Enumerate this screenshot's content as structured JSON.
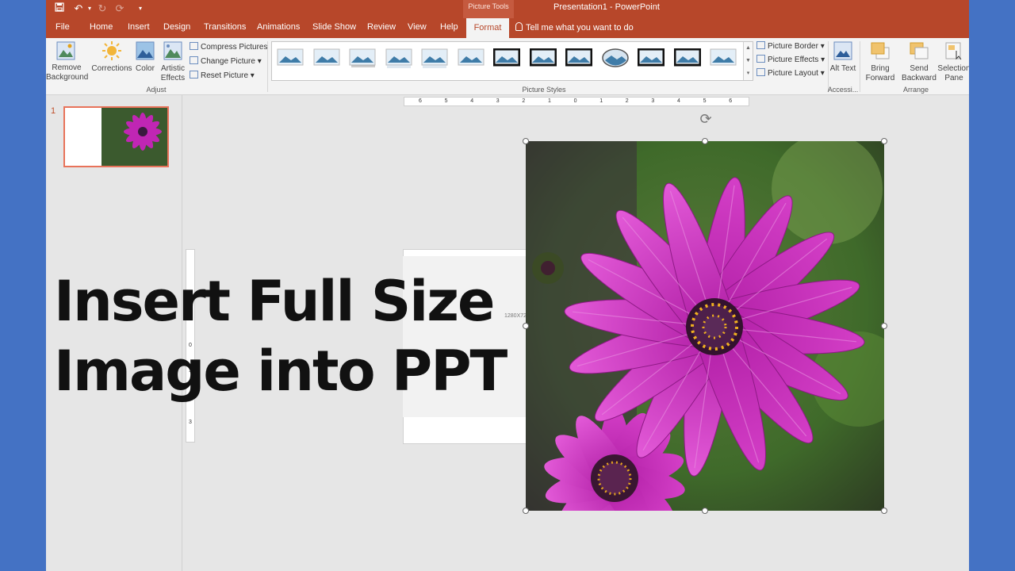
{
  "app": {
    "window_title": "Presentation1  -  PowerPoint",
    "context_tab_group": "Picture Tools",
    "tell_me": "Tell me what you want to do",
    "colors": {
      "accent": "#b7472a",
      "frame": "#4472c4",
      "selection": "#e8735a"
    }
  },
  "quick_access": [
    {
      "icon": "save-icon",
      "glyph": "💾"
    },
    {
      "icon": "undo-icon",
      "glyph": "↶"
    },
    {
      "icon": "redo-icon",
      "glyph": "↻"
    },
    {
      "icon": "customize-icon",
      "glyph": "▾"
    }
  ],
  "tabs": [
    "File",
    "Home",
    "Insert",
    "Design",
    "Transitions",
    "Animations",
    "Slide Show",
    "Review",
    "View",
    "Help"
  ],
  "active_tab": "Format",
  "ribbon": {
    "adjust": {
      "remove_background": "Remove Background",
      "corrections": "Corrections",
      "color": "Color",
      "artistic_effects": "Artistic Effects",
      "compress": "Compress Pictures",
      "change": "Change Picture",
      "reset": "Reset Picture",
      "group_name": "Adjust"
    },
    "picture_styles": {
      "group_name": "Picture Styles",
      "picture_border": "Picture Border",
      "picture_effects": "Picture Effects",
      "picture_layout": "Picture Layout"
    },
    "accessibility": {
      "alt_text": "Alt Text",
      "group_name": "Accessi..."
    },
    "arrange": {
      "bring_forward": "Bring Forward",
      "send_backward": "Send Backward",
      "selection_pane": "Selection Pane",
      "group_name": "Arrange"
    }
  },
  "slides_pane": {
    "slide_number": "1"
  },
  "rulers": {
    "horizontal": [
      "6",
      "5",
      "4",
      "3",
      "2",
      "1",
      "0",
      "1",
      "2",
      "3",
      "4",
      "5",
      "6"
    ],
    "vertical": [
      "1",
      "0",
      "1",
      "2",
      "3"
    ]
  },
  "slide": {
    "size_label": "1280X72"
  },
  "overlay": {
    "line1": "Insert Full Size",
    "line2": "Image into PPT"
  }
}
